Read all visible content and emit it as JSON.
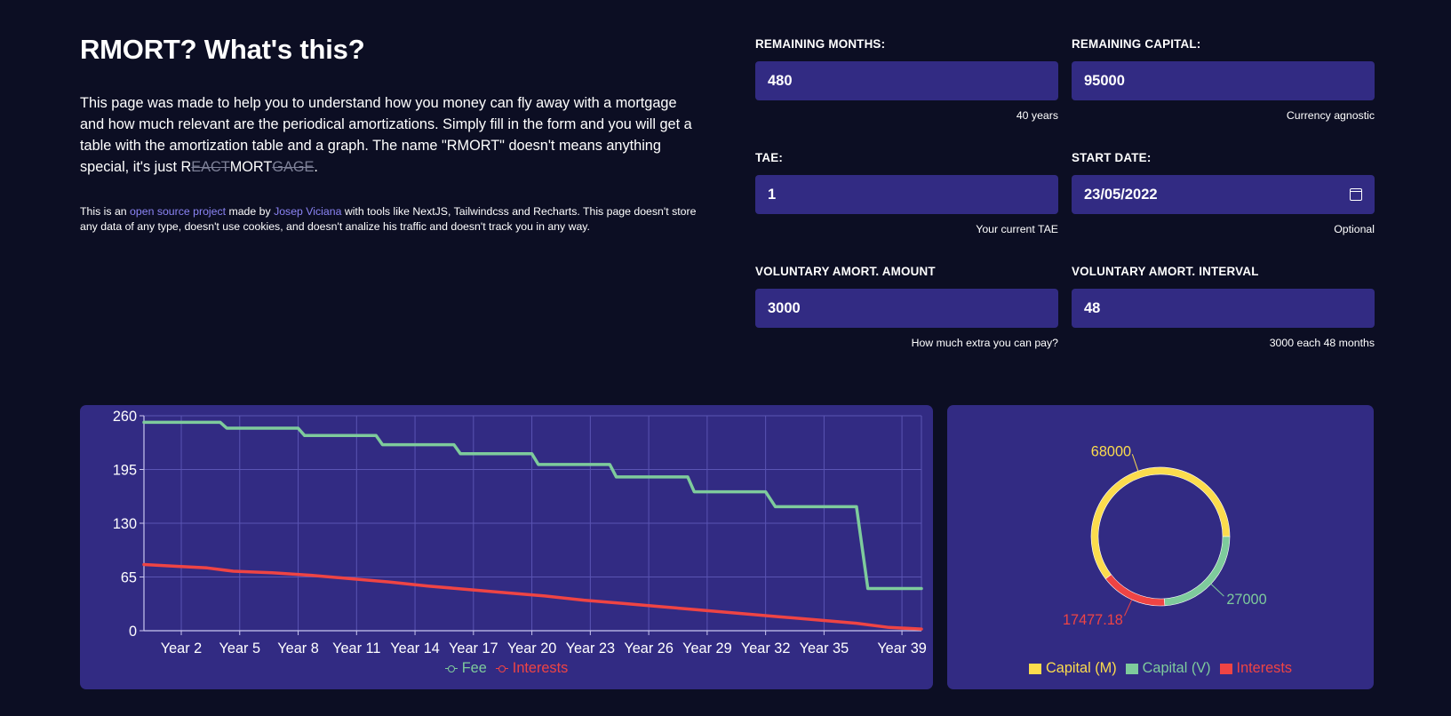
{
  "intro": {
    "title": "RMORT? What's this?",
    "paragraph": "This page was made to help you to understand how you money can fly away with a mortgage and how much relevant are the periodical amortizations. Simply fill in the form and you will get a table with the amortization table and a graph. The name \"RMORT\" doesn't means anything special, it's just ",
    "name_r": "R",
    "name_eact": "EACT",
    "name_mort": "MORT",
    "name_gage": "GAGE",
    "name_end": ".",
    "small_1": "This is an ",
    "link_project": "open source project",
    "small_2": " made by ",
    "link_author": "Josep Viciana",
    "small_3": " with tools like NextJS, Tailwindcss and Recharts. This page doesn't store any data of any type, doesn't use cookies, and doesn't analize his traffic and doesn't track you in any way."
  },
  "form": {
    "remaining_months": {
      "label": "REMAINING MONTHS:",
      "value": "480",
      "hint": "40 years"
    },
    "remaining_capital": {
      "label": "REMAINING CAPITAL:",
      "value": "95000",
      "hint": "Currency agnostic"
    },
    "tae": {
      "label": "TAE:",
      "value": "1",
      "hint": "Your current TAE"
    },
    "start_date": {
      "label": "START DATE:",
      "value": "23/05/2022",
      "hint": "Optional"
    },
    "amort_amount": {
      "label": "VOLUNTARY AMORT. AMOUNT",
      "value": "3000",
      "hint": "How much extra you can pay?"
    },
    "amort_interval": {
      "label": "VOLUNTARY AMORT. INTERVAL",
      "value": "48",
      "hint": "3000 each 48 months"
    }
  },
  "colors": {
    "fee": "#7ecb9c",
    "interests": "#ef4444",
    "capital_m": "#fcdc4d",
    "capital_v": "#7ecb9c",
    "card": "#322b83",
    "grid": "#5a54b3"
  },
  "chart_data": [
    {
      "type": "line",
      "x_ticks": [
        "Year 2",
        "Year 5",
        "Year 8",
        "Year 11",
        "Year 14",
        "Year 17",
        "Year 20",
        "Year 23",
        "Year 26",
        "Year 29",
        "Year 32",
        "Year 35",
        "Year 39"
      ],
      "ylim": [
        0,
        260
      ],
      "y_ticks": [
        0,
        65,
        130,
        195,
        260
      ],
      "x_unit": "month",
      "x_range": [
        1,
        480
      ],
      "grid": true,
      "legend_position": "bottom",
      "series": [
        {
          "name": "Fee",
          "points": [
            [
              1,
              252
            ],
            [
              48,
              252
            ],
            [
              52,
              245
            ],
            [
              96,
              245
            ],
            [
              100,
              236
            ],
            [
              144,
              236
            ],
            [
              148,
              225
            ],
            [
              192,
              225
            ],
            [
              196,
              214
            ],
            [
              240,
              214
            ],
            [
              244,
              201
            ],
            [
              288,
              201
            ],
            [
              292,
              186
            ],
            [
              336,
              186
            ],
            [
              340,
              168
            ],
            [
              384,
              168
            ],
            [
              390,
              150
            ],
            [
              440,
              150
            ],
            [
              447,
              51
            ],
            [
              480,
              51
            ]
          ]
        },
        {
          "name": "Interests",
          "points": [
            [
              1,
              80
            ],
            [
              20,
              78
            ],
            [
              40,
              76
            ],
            [
              56,
              72
            ],
            [
              80,
              70
            ],
            [
              104,
              67
            ],
            [
              128,
              63
            ],
            [
              152,
              59
            ],
            [
              176,
              54
            ],
            [
              200,
              50
            ],
            [
              224,
              46
            ],
            [
              248,
              42
            ],
            [
              272,
              37
            ],
            [
              296,
              33
            ],
            [
              320,
              29
            ],
            [
              344,
              25
            ],
            [
              368,
              21
            ],
            [
              392,
              17
            ],
            [
              416,
              13
            ],
            [
              440,
              9
            ],
            [
              460,
              4
            ],
            [
              480,
              2
            ]
          ]
        }
      ]
    },
    {
      "type": "pie",
      "slices": [
        {
          "name": "Capital (M)",
          "value": 68000,
          "label": "68000"
        },
        {
          "name": "Interests",
          "value": 17477.18,
          "label": "17477.18"
        },
        {
          "name": "Capital (V)",
          "value": 27000,
          "label": "27000"
        }
      ],
      "legend": [
        "Capital (M)",
        "Capital (V)",
        "Interests"
      ],
      "legend_position": "bottom"
    }
  ]
}
